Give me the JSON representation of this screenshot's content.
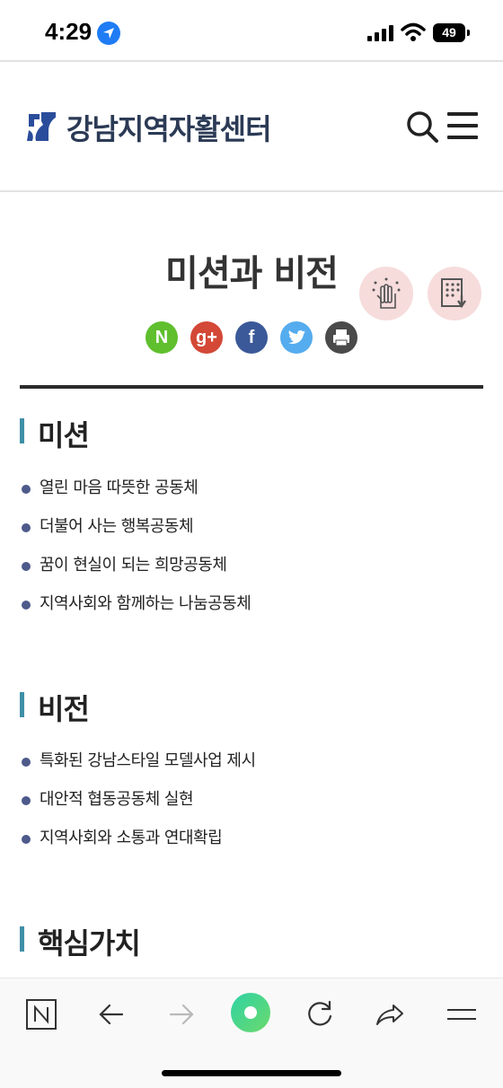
{
  "status_bar": {
    "time": "4:29",
    "battery": "49"
  },
  "header": {
    "logo_text": "강남지역자활센터",
    "colors": {
      "brand": "#2b3a55",
      "logo_mark": "#2a4d9b"
    }
  },
  "page": {
    "title": "미션과 비전"
  },
  "share_buttons": [
    {
      "name": "naver",
      "glyph": "N",
      "color": "#5fbf2d"
    },
    {
      "name": "google-plus",
      "glyph": "g+",
      "color": "#d34836"
    },
    {
      "name": "facebook",
      "glyph": "f",
      "color": "#3b5998"
    },
    {
      "name": "twitter",
      "color": "#55acee"
    },
    {
      "name": "print",
      "color": "#4a4a4a"
    }
  ],
  "sections": {
    "mission": {
      "title": "미션",
      "items": [
        "열린 마음 따뜻한 공동체",
        "더불어 사는 행복공동체",
        "꿈이 현실이 되는 희망공동체",
        "지역사회와 함께하는 나눔공동체"
      ]
    },
    "vision": {
      "title": "비전",
      "items": [
        "특화된 강남스타일 모델사업 제시",
        "대안적 협동공동체 실현",
        "지역사회와 소통과 연대확립"
      ]
    },
    "core_values": {
      "title": "핵심가치"
    }
  },
  "browser_bar": {
    "buttons": [
      "naver-home",
      "back",
      "forward",
      "green-dot",
      "reload",
      "share",
      "menu"
    ],
    "accent": "#3ecf8e"
  }
}
